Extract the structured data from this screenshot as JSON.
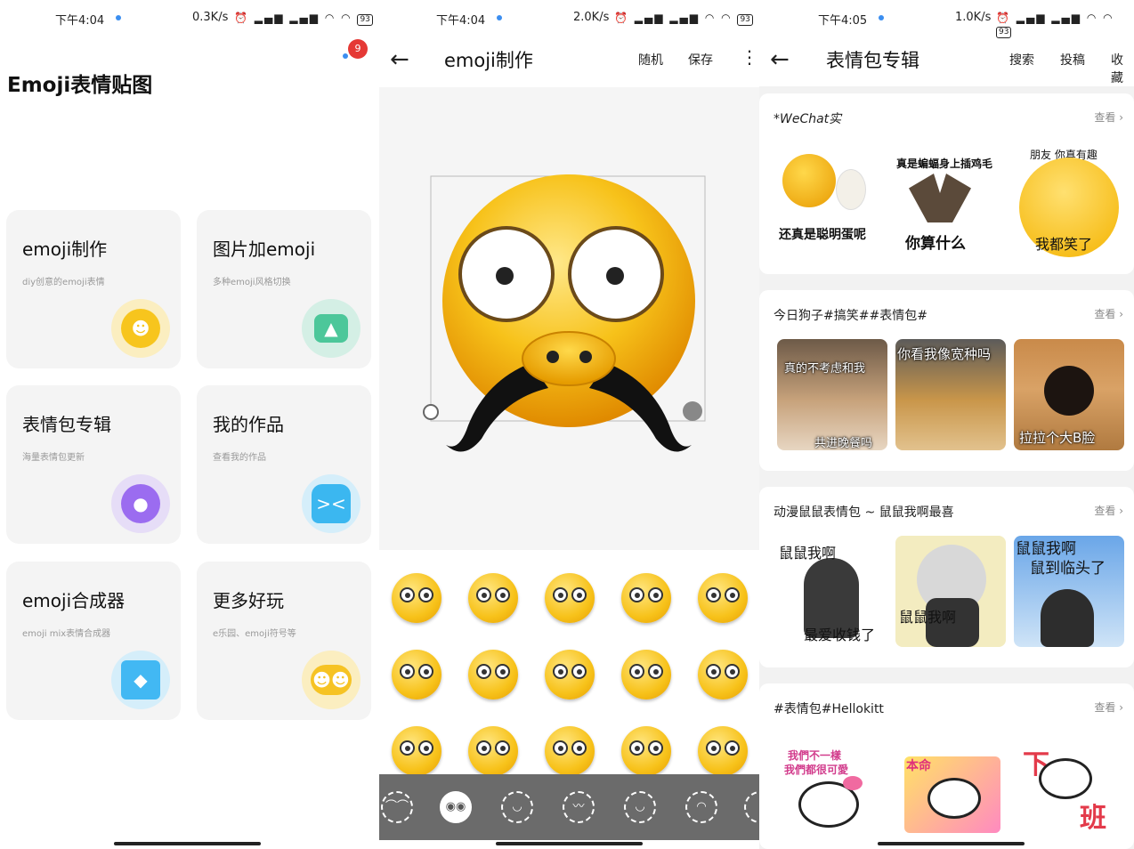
{
  "p1": {
    "status": {
      "time": "下午4:04",
      "speed": "0.3K/s",
      "battery": "93"
    },
    "app_title": "Emoji表情贴图",
    "notification_count": "9",
    "cards": [
      {
        "title": "emoji制作",
        "subtitle": "diy创意的emoji表情",
        "icon": "smiley-icon",
        "color": "#f7c51d"
      },
      {
        "title": "图片加emoji",
        "subtitle": "多种emoji风格切换",
        "icon": "image-icon",
        "color": "#4cc79a"
      },
      {
        "title": "表情包专辑",
        "subtitle": "海量表情包更新",
        "icon": "palette-icon",
        "color": "#9b6cf0"
      },
      {
        "title": "我的作品",
        "subtitle": "查看我的作品",
        "icon": "ghost-icon",
        "color": "#3bb7f0"
      },
      {
        "title": "emoji合成器",
        "subtitle": "emoji mix表情合成器",
        "icon": "cube-icon",
        "color": "#42b8f3"
      },
      {
        "title": "更多好玩",
        "subtitle": "e乐园、emoji符号等",
        "icon": "twin-emoji-icon",
        "color": "#f6c324"
      }
    ]
  },
  "p2": {
    "status": {
      "time": "下午4:04",
      "speed": "2.0K/s",
      "battery": "93"
    },
    "title": "emoji制作",
    "actions": [
      "随机",
      "保存"
    ],
    "tabs": [
      "eyes-closed",
      "eyes",
      "mouth",
      "mustache",
      "smile",
      "frown"
    ]
  },
  "p3": {
    "status": {
      "time": "下午4:05",
      "speed": "1.0K/s",
      "battery": "93"
    },
    "title": "表情包专辑",
    "actions": [
      "搜索",
      "投稿",
      "收藏"
    ],
    "more_label": "查看",
    "sections": [
      {
        "title": "*WeChat实",
        "captions": [
          "还真是聪明蛋呢",
          "真是蝙蝠身上插鸡毛",
          "你算什么",
          "朋友 你真有趣",
          "我都笑了"
        ]
      },
      {
        "title": "今日狗子#搞笑##表情包#",
        "captions": [
          "真的不考虑和我",
          "共进晚餐吗",
          "你看我像宽种吗",
          "拉拉个大B脸"
        ]
      },
      {
        "title": "动漫鼠鼠表情包 ~ 鼠鼠我啊最喜",
        "captions": [
          "鼠鼠我啊",
          "最爱收钱了",
          "鼠鼠我啊",
          "鼠鼠我啊",
          "鼠到临头了"
        ]
      },
      {
        "title": "#表情包#Hellokitt",
        "captions": [
          "我們不一樣",
          "我們都很可愛",
          "本命",
          "下",
          "班"
        ]
      }
    ]
  }
}
